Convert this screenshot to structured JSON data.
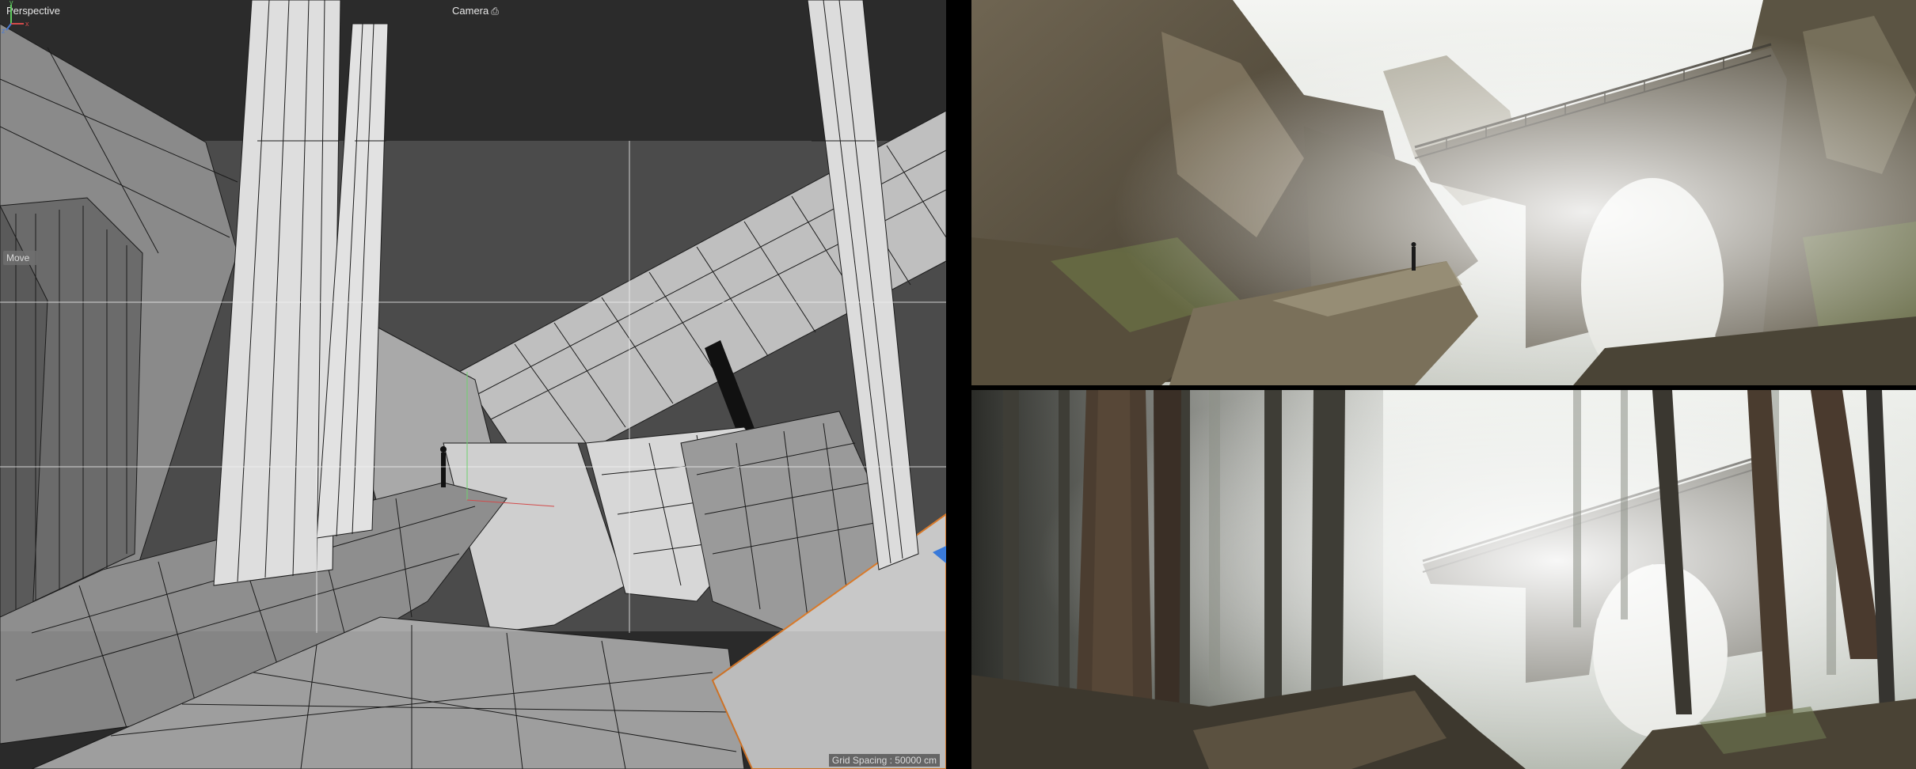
{
  "viewport": {
    "label": "Perspective",
    "camera_label": "Camera",
    "camera_icon": "camera-icon",
    "tool_label": "Move",
    "grid_spacing": "Grid Spacing : 50000 cm",
    "axis_gizmo": {
      "y": "y",
      "z": "z",
      "x": "x"
    },
    "colors": {
      "background": "#2d2d2d",
      "geometry_light": "#d4d4d4",
      "geometry_dark": "#6a6a6a",
      "wire": "#1a1a1a",
      "selection_edge": "#d97a2a"
    }
  },
  "renders": {
    "top": {
      "name": "canyon-bridge-render"
    },
    "bottom": {
      "name": "forest-bridge-render"
    }
  }
}
